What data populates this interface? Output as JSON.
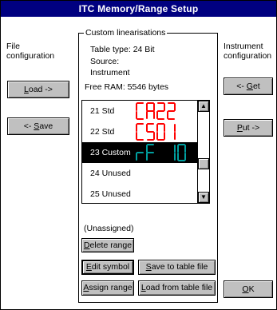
{
  "window": {
    "title": "ITC Memory/Range Setup"
  },
  "left": {
    "heading_line1": "File",
    "heading_line2": "configuration",
    "load_button_mnemonic": "L",
    "load_button_rest": "oad ->",
    "save_button_prefix": "<- ",
    "save_button_mnemonic": "S",
    "save_button_rest": "ave"
  },
  "right": {
    "heading_line1": "Instrument",
    "heading_line2": "configuration",
    "get_button_prefix": "<- ",
    "get_button_mnemonic": "G",
    "get_button_rest": "et",
    "put_button_mnemonic": "P",
    "put_button_rest": "ut ->",
    "ok_button_mnemonic": "O",
    "ok_button_rest": "K"
  },
  "custom": {
    "group_title": "Custom linearisations",
    "table_type": "Table type:  24 Bit",
    "source": "Source:",
    "source_value": "Instrument",
    "free_ram": "Free RAM: 5546 bytes",
    "ranges": [
      {
        "label": "21 Std",
        "symbol": "CA22",
        "symbol_color": "#ff0000",
        "selected": false
      },
      {
        "label": "22 Std",
        "symbol": "CS01",
        "symbol_color": "#ff0000",
        "selected": false
      },
      {
        "label": "23 Custom",
        "symbol": "rF 10",
        "symbol_color": "#00a0a0",
        "selected": true
      },
      {
        "label": "24 Unused",
        "symbol": "",
        "symbol_color": "#000000",
        "selected": false
      },
      {
        "label": "25 Unused",
        "symbol": "",
        "symbol_color": "#000000",
        "selected": false
      }
    ],
    "scroll_up": "▲",
    "scroll_down": "▼",
    "status": "(Unassigned)",
    "delete_button_mnemonic": "D",
    "delete_button_rest": "elete range",
    "edit_button_mnemonic": "E",
    "edit_button_rest": "dit symbol",
    "save_table_button_mnemonic": "S",
    "save_table_button_rest": "ave to table file",
    "assign_button_mnemonic": "A",
    "assign_button_rest": "ssign range",
    "load_table_button_mnemonic": "L",
    "load_table_button_rest": "oad from table file"
  }
}
